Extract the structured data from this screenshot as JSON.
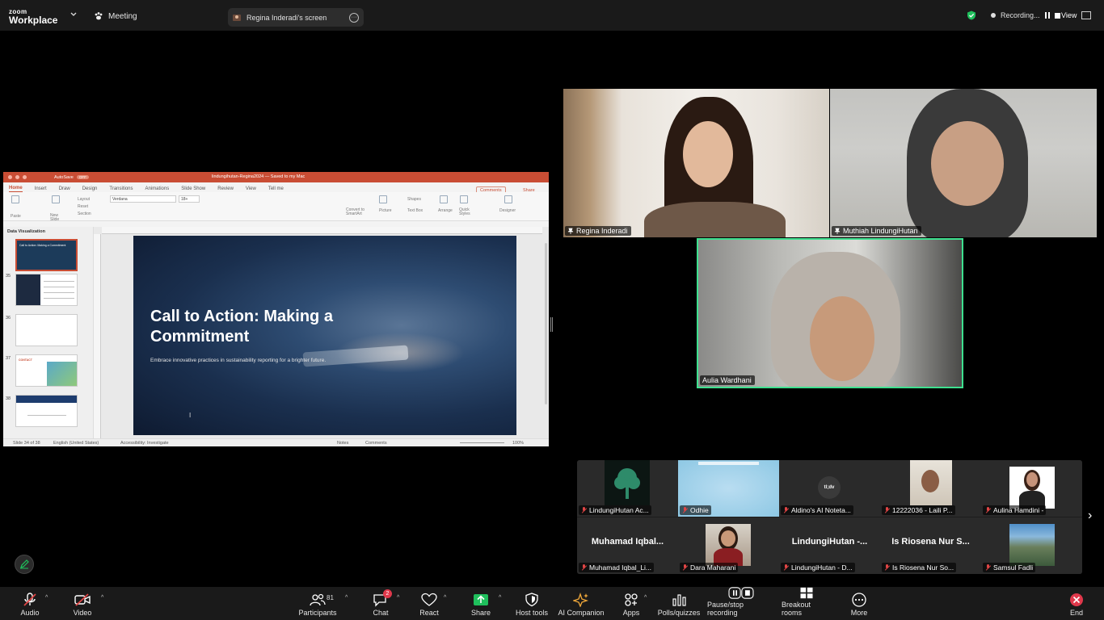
{
  "app": {
    "logo_top": "zoom",
    "logo_bottom": "Workplace",
    "meeting_label": "Meeting",
    "share_label": "Regina Inderadi's screen",
    "recording_label": "Recording...",
    "view_label": "View"
  },
  "ppt": {
    "autosave": "AutoSave",
    "autosave_state": "OFF",
    "file_title": "lindungihutan-Regina2024 — Saved to my Mac",
    "tabs": [
      "Home",
      "Insert",
      "Draw",
      "Design",
      "Transitions",
      "Animations",
      "Slide Show",
      "Review",
      "View",
      "Tell me"
    ],
    "comments_btn": "Comments",
    "share_btn": "Share",
    "ribbon": {
      "paste": "Paste",
      "new_slide": "New Slide",
      "layout": "Layout",
      "reset": "Reset",
      "section": "Section",
      "font": "Verdana",
      "size": "18+",
      "convert": "Convert to SmartArt",
      "picture": "Picture",
      "shapes": "Shapes",
      "text_box": "Text Box",
      "arrange": "Arrange",
      "quick_styles": "Quick Styles",
      "designer": "Designer"
    },
    "section_header": "Data Visualization",
    "thumbs": [
      {
        "num": "",
        "title": "Call to Action: Making a Commitment"
      },
      {
        "num": "35",
        "title": ""
      },
      {
        "num": "36",
        "title": ""
      },
      {
        "num": "37",
        "title": "CONTACT"
      },
      {
        "num": "38",
        "title": ""
      }
    ],
    "slide": {
      "title": "Call to Action: Making a Commitment",
      "subtitle": "Embrace innovative practices in sustainability reporting for a brighter future."
    },
    "status": {
      "slide_count": "Slide 34 of 38",
      "language": "English (United States)",
      "accessibility": "Accessibility: Investigate",
      "notes": "Notes",
      "comments": "Comments",
      "zoom": "100%"
    }
  },
  "videos": {
    "regina": "Regina Inderadi",
    "muthiah": "Muthiah LindungiHutan",
    "aulia": "Aulia Wardhani"
  },
  "gallery": [
    {
      "name": "LindungiHutan Ac...",
      "big": ""
    },
    {
      "name": "Odhie",
      "big": ""
    },
    {
      "name": "Aldino's AI Noteta...",
      "big": "",
      "logo": "tl;dv"
    },
    {
      "name": "12222036 - Laili P...",
      "big": ""
    },
    {
      "name": "Aulina Hamdini -",
      "big": ""
    },
    {
      "name": "Muhamad Iqbal_Li...",
      "big": "Muhamad  Iqbal..."
    },
    {
      "name": "Dara Maharani",
      "big": ""
    },
    {
      "name": "LindungiHutan - D...",
      "big": "LindungiHutan  -..."
    },
    {
      "name": "Is Riosena Nur So...",
      "big": "Is Riosena Nur S..."
    },
    {
      "name": "Samsul Fadli",
      "big": ""
    }
  ],
  "controls": {
    "audio": "Audio",
    "video": "Video",
    "participants": "Participants",
    "participants_count": "81",
    "chat": "Chat",
    "chat_badge": "2",
    "react": "React",
    "share": "Share",
    "host_tools": "Host tools",
    "ai_companion": "AI Companion",
    "apps": "Apps",
    "polls": "Polls/quizzes",
    "pause_rec": "Pause/stop recording",
    "breakout": "Breakout rooms",
    "more": "More",
    "end": "End"
  },
  "colors": {
    "ppt_accent": "#c94d34",
    "active_speaker": "#3ee08f",
    "share_green": "#1fbf5c",
    "muted_red": "#e04545",
    "end_red": "#e0384b"
  }
}
